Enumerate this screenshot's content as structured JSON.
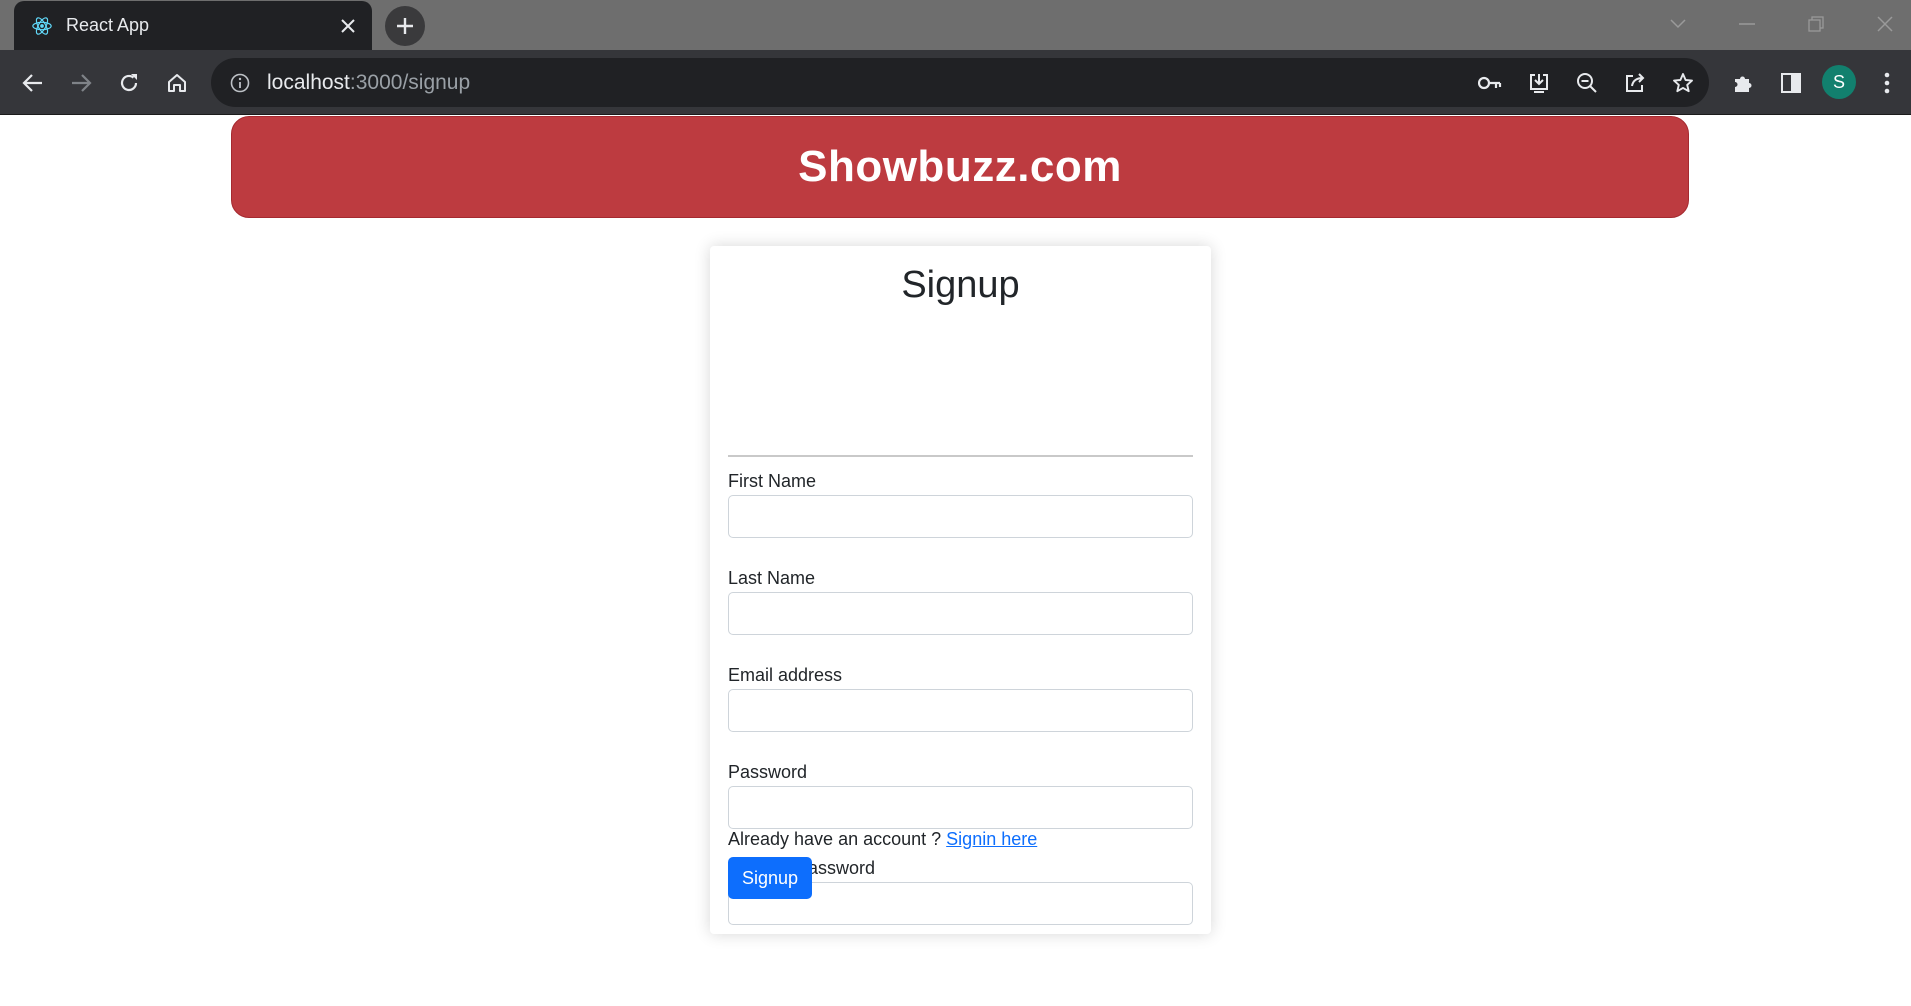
{
  "browser": {
    "tab_title": "React App",
    "url_host": "localhost",
    "url_path": ":3000/signup",
    "profile_initial": "S"
  },
  "banner": {
    "title": "Showbuzz.com",
    "color": "#bd3b40"
  },
  "form": {
    "heading": "Signup",
    "fields": [
      {
        "label": "First Name",
        "value": "",
        "placeholder": ""
      },
      {
        "label": "Last Name",
        "value": "",
        "placeholder": ""
      },
      {
        "label": "Email address",
        "value": "",
        "placeholder": ""
      },
      {
        "label": "Password",
        "value": "",
        "placeholder": ""
      },
      {
        "label": "Confirm Password",
        "value": "",
        "placeholder": ""
      }
    ],
    "account_prompt": "Already have an account ?",
    "signin_link": "Signin here",
    "submit_label": "Signup",
    "submit_color": "#0d6efd"
  },
  "icons": {
    "tab_favicon": "react-logo-icon",
    "tab_close": "close-icon",
    "new_tab": "plus-icon",
    "back": "arrow-left-icon",
    "forward": "arrow-right-icon",
    "reload": "reload-icon",
    "home": "home-icon",
    "site_info": "info-icon",
    "password": "key-icon",
    "install": "install-icon",
    "zoom": "zoom-out-icon",
    "share": "share-icon",
    "bookmark": "star-icon",
    "extensions": "puzzle-icon",
    "side_panel": "side-panel-icon",
    "menu": "kebab-menu-icon"
  }
}
